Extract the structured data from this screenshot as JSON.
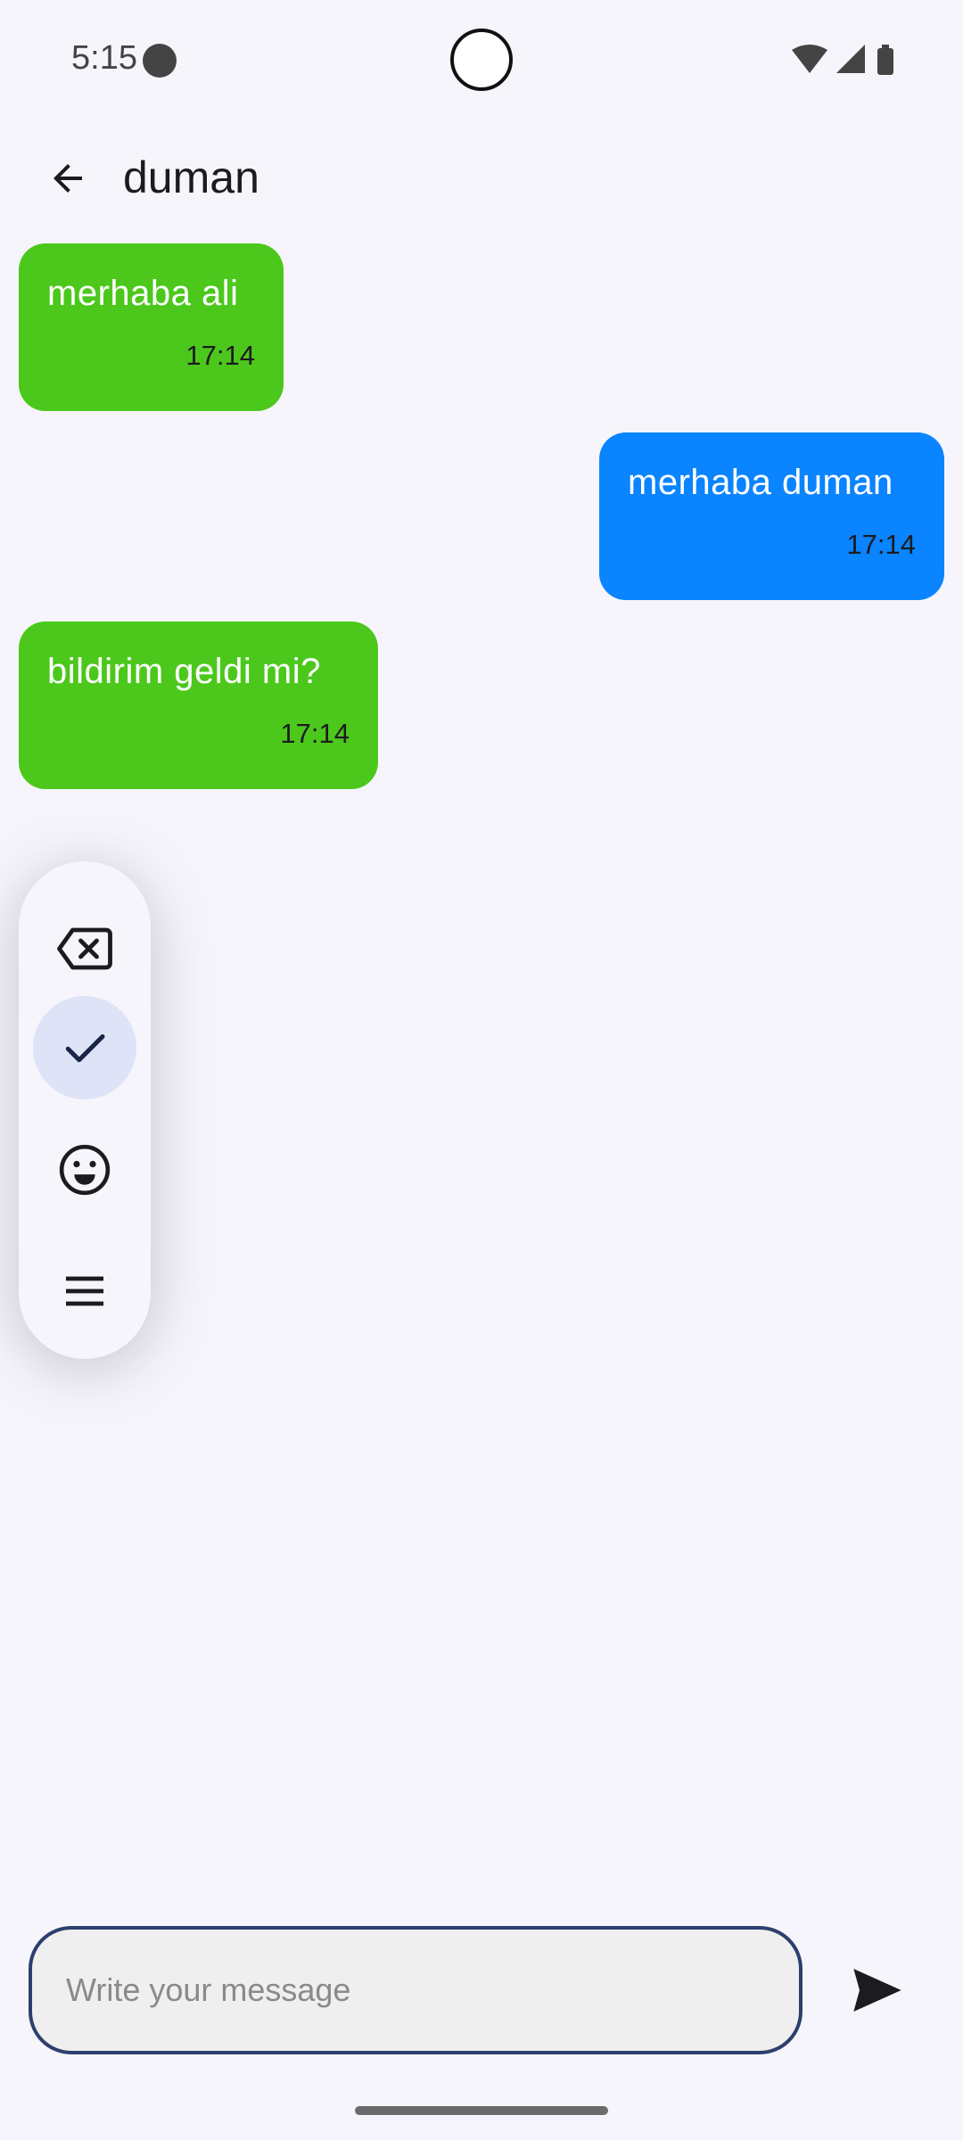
{
  "status_bar": {
    "time": "5:15"
  },
  "header": {
    "title": "duman"
  },
  "messages": [
    {
      "text": "merhaba ali",
      "time": "17:14",
      "direction": "received",
      "color": "#4cc81c"
    },
    {
      "text": "merhaba duman",
      "time": "17:14",
      "direction": "sent",
      "color": "#0a84ff"
    },
    {
      "text": "bildirim geldi mi?",
      "time": "17:14",
      "direction": "received",
      "color": "#4cc81c"
    }
  ],
  "floating_toolbar": {
    "items": [
      {
        "icon": "backspace-icon"
      },
      {
        "icon": "check-icon",
        "selected": true
      },
      {
        "icon": "emoji-icon"
      },
      {
        "icon": "menu-icon"
      }
    ]
  },
  "composer": {
    "placeholder": "Write your message",
    "value": ""
  }
}
